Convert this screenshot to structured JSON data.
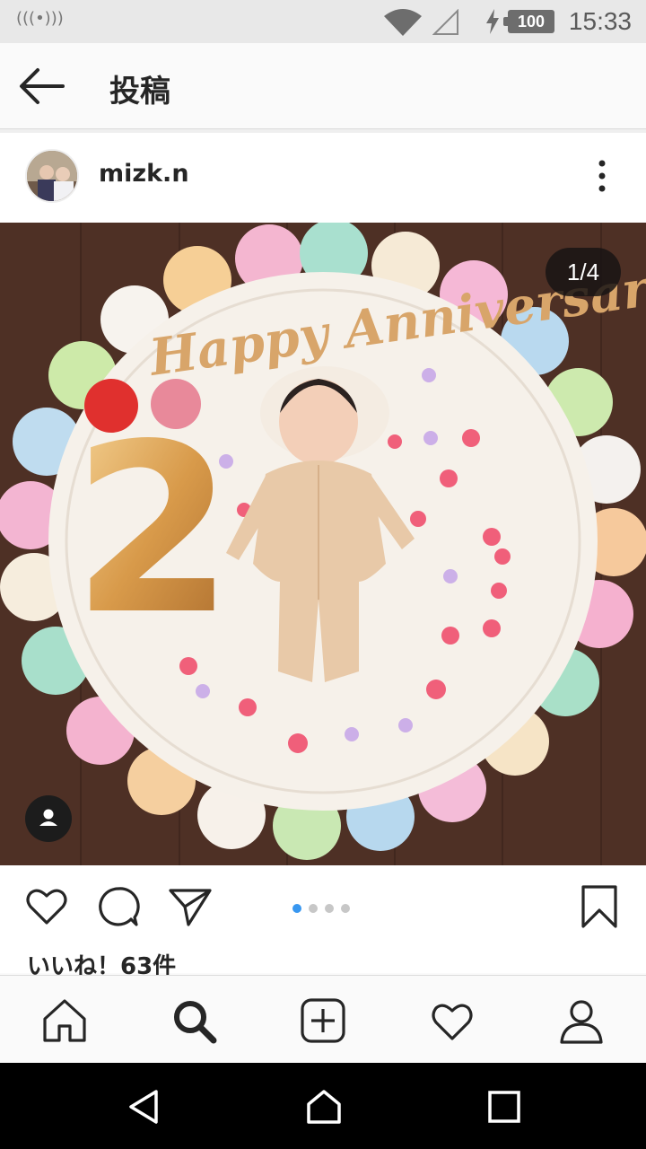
{
  "status": {
    "signal_icon": "(((•)))",
    "battery": "100",
    "time": "15:33"
  },
  "header": {
    "title": "投稿"
  },
  "post": {
    "username": "mizk.n",
    "counter": "1/4",
    "photo_text": "Happy Anniversary",
    "balloon_number": "2",
    "likes": "いいね！63件",
    "carousel": {
      "count": 4,
      "active": 1
    }
  },
  "colors": {
    "accent": "#3897f0",
    "text": "#262626",
    "wood": "#4e3025",
    "mat": "#f6f1ea"
  }
}
